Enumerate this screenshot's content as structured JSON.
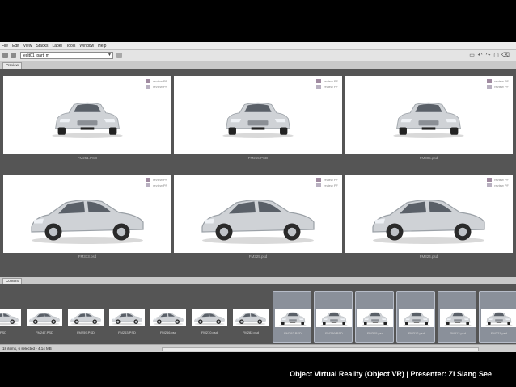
{
  "menu": [
    "File",
    "Edit",
    "View",
    "Stacks",
    "Label",
    "Tools",
    "Window",
    "Help"
  ],
  "path": {
    "value": "edit01_part_m"
  },
  "tabs": {
    "preview": "Preview",
    "content": "Content"
  },
  "legend": [
    "review PF",
    "review PF"
  ],
  "colors": {
    "legend1": "#a08aa0",
    "legend2": "#b8b0c0"
  },
  "preview_items": [
    {
      "caption": "FM251.PSD"
    },
    {
      "caption": "FM255.PSD"
    },
    {
      "caption": "FM305.psd"
    },
    {
      "caption": "FM313.psd"
    },
    {
      "caption": "FM325.psd"
    },
    {
      "caption": "FM324.psd"
    }
  ],
  "content_items": [
    {
      "caption": "PSD",
      "selected": false
    },
    {
      "caption": "FM247.PSD",
      "selected": false
    },
    {
      "caption": "FM259.PSD",
      "selected": false
    },
    {
      "caption": "FM263.PSD",
      "selected": false
    },
    {
      "caption": "FM266.psd",
      "selected": false
    },
    {
      "caption": "FM270.psd",
      "selected": false
    },
    {
      "caption": "FM282.psd",
      "selected": false
    },
    {
      "caption": "FM292.PSD",
      "selected": true
    },
    {
      "caption": "FM299.PSD",
      "selected": true
    },
    {
      "caption": "FM305.psd",
      "selected": true
    },
    {
      "caption": "FM312.psd",
      "selected": true
    },
    {
      "caption": "FM313.psd",
      "selected": true
    },
    {
      "caption": "FM321.psd",
      "selected": true
    }
  ],
  "status": "18 items, 6 selected - 4.14 MB",
  "footer": "Object Virtual Reality (Object VR) | Presenter: Zi Siang See"
}
